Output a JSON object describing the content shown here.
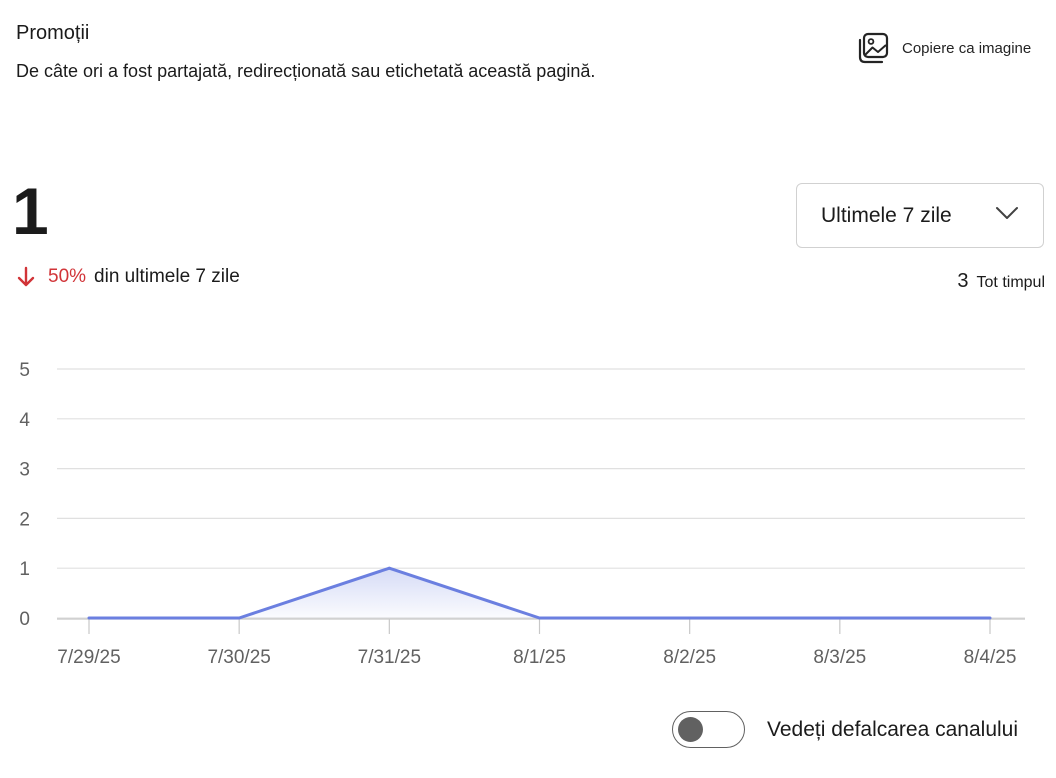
{
  "header": {
    "title": "Promoții",
    "subtitle": "De câte ori a fost partajată, redirecționată sau etichetată această pagină.",
    "copy_label": "Copiere ca imagine",
    "copy_icon": "image-icon"
  },
  "summary": {
    "value": "1",
    "change_pct": "50%",
    "change_direction": "down",
    "change_period": "din ultimele 7 zile",
    "change_color": "#d13438",
    "alltime_value": "3",
    "alltime_label": "Tot timpul"
  },
  "range": {
    "selected": "Ultimele 7 zile"
  },
  "chart_data": {
    "type": "area",
    "categories": [
      "7/29/25",
      "7/30/25",
      "7/31/25",
      "8/1/25",
      "8/2/25",
      "8/3/25",
      "8/4/25"
    ],
    "series": [
      {
        "values": [
          0,
          0,
          1,
          0,
          0,
          0,
          0
        ]
      }
    ],
    "y_ticks": [
      "0",
      "1",
      "2",
      "3",
      "4",
      "5"
    ],
    "ylim": [
      0,
      5
    ],
    "grid": true,
    "line_color": "#6b7fe0"
  },
  "toggle": {
    "label": "Vedeți defalcarea canalului",
    "checked": false
  }
}
